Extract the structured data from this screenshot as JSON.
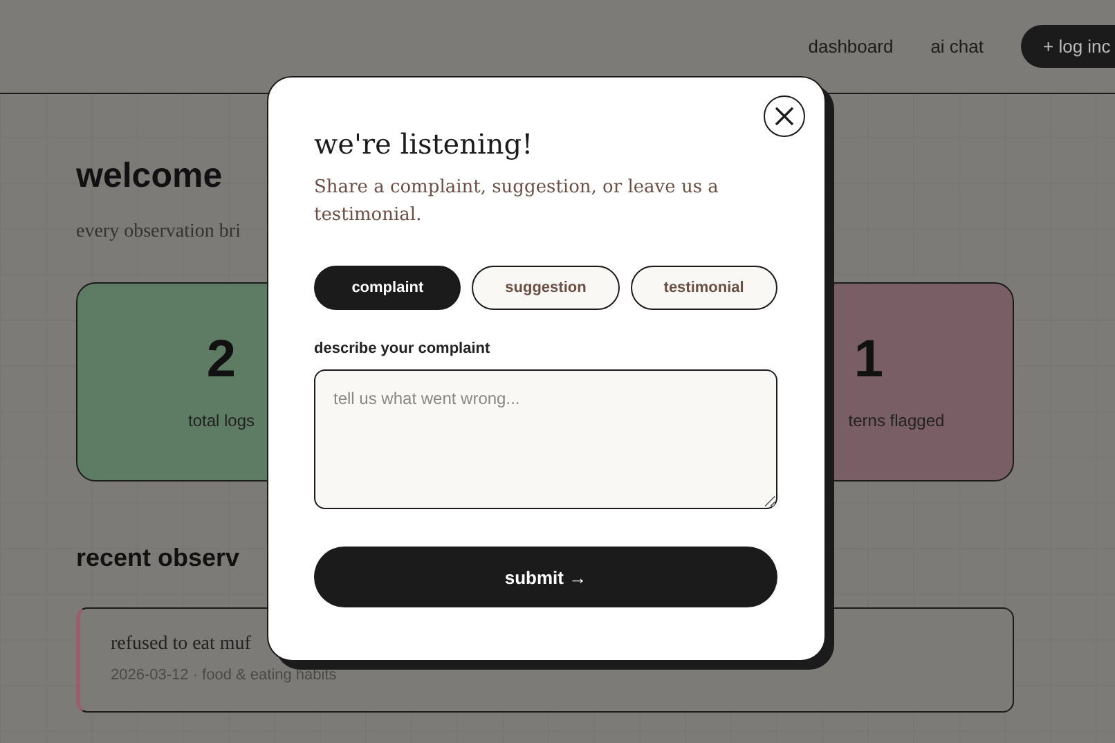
{
  "nav": {
    "links": [
      "dashboard",
      "ai chat"
    ],
    "action": "+ log inc"
  },
  "page": {
    "heading": "welcome",
    "subtitle": "every observation bri",
    "stats": [
      {
        "value": "2",
        "label": "total logs",
        "color": "#5e7b64"
      },
      {
        "value": "1",
        "label": "terns flagged",
        "color": "#795e66"
      }
    ],
    "recent_heading": "recent observ",
    "observations": [
      {
        "title": "refused to eat muf",
        "meta": "2026-03-12 · food & eating habits",
        "color": "#9a5f6c"
      }
    ]
  },
  "modal": {
    "title": "we're listening!",
    "description": "Share a complaint, suggestion, or leave us a testimonial.",
    "tabs": [
      {
        "label": "complaint",
        "selected": true
      },
      {
        "label": "suggestion",
        "selected": false
      },
      {
        "label": "testimonial",
        "selected": false
      }
    ],
    "field_label": "describe your complaint",
    "placeholder": "tell us what went wrong...",
    "submit": "submit →"
  }
}
